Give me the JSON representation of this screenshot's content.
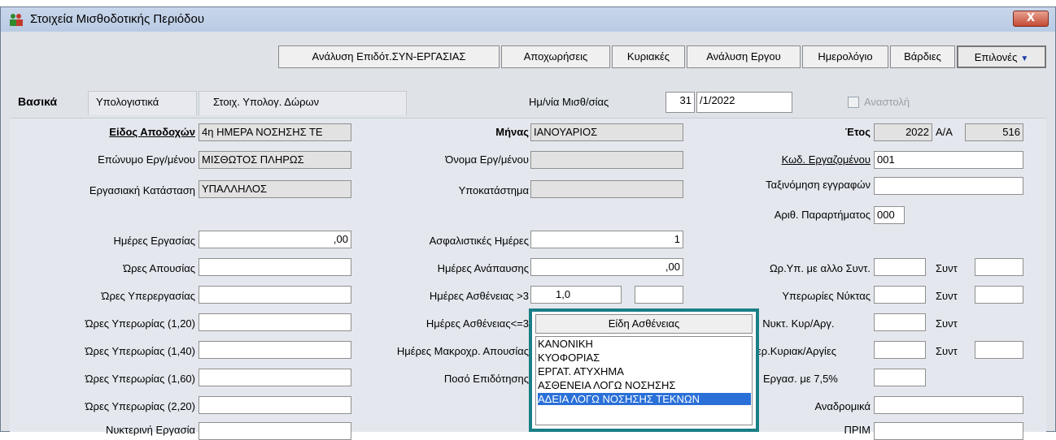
{
  "window": {
    "title": "Στοιχεία Μισθοδοτικής Περιόδου",
    "close": "X"
  },
  "toolbar": {
    "buttons": [
      "Ανάλυση Επιδότ.ΣΥΝ-ΕΡΓΑΣΙΑΣ",
      "Αποχωρήσεις",
      "Κυριακές",
      "Ανάλυση Εργου",
      "Ημερολόγιο",
      "Βάρδιες"
    ],
    "options": "Επιλονές"
  },
  "tabs": [
    "Βασικά",
    "Υπολογιστικά",
    "Στοιχ. Υπολογ. Δώρων"
  ],
  "header": {
    "date_label": "Ημ/νία Μισθ/σίας",
    "date_day": "31",
    "date_rest": "/1/2022",
    "suspend": "Αναστολή"
  },
  "form": {
    "income_type_label": "Είδος Αποδοχών",
    "income_type_value": "4η ΗΜΕΡΑ ΝΟΣΗΣΗΣ ΤΕ",
    "month_label": "Μήνας",
    "month_value": "ΙΑΝΟΥΑΡΙΟΣ",
    "year_label": "Έτος",
    "year_value": "2022",
    "aa_label": "Α/Α",
    "aa_value": "516",
    "surname_label": "Επώνυμο Εργ/μένου",
    "surname_value": "ΜΙΣΘΩΤΟΣ ΠΛΗΡΩΣ",
    "name_label": "Όνομα Εργ/μένου",
    "name_value": "",
    "emp_code_label": "Κωδ. Εργαζομένου",
    "emp_code_value": "001",
    "status_label": "Εργασιακή Κατάσταση",
    "status_value": "ΥΠΑΛΛΗΛΟΣ",
    "branch_label": "Υποκατάστημα",
    "branch_value": "",
    "sort_label": "Ταξινόμηση εγγραφών",
    "sort_value": "",
    "annex_label": "Αριθ. Παραρτήματος",
    "annex_value": "000",
    "work_days_label": "Ημέρες Εργασίας",
    "work_days_value": ",00",
    "ins_days_label": "Ασφαλιστικές Ημέρες",
    "ins_days_value": "1",
    "absence_hours_label": "Ώρες Απουσίας",
    "rest_days_label": "Ημέρες Ανάπαυσης",
    "rest_days_value": ",00",
    "overtime_other_label": "Ωρ.Υπ. με αλλο Συντ.",
    "synt_label": "Συντ",
    "overwork_label": "Ώρες Υπερεργασίας",
    "sick_gt3_label": "Ημέρες Ασθένειας >3",
    "sick_gt3_value": "1,0",
    "night_overtime_label": "Υπερωρίες Νύκτας",
    "overtime_120_label": "Ώρες Υπερωρίας (1,20)",
    "sick_le3_label": "Ημέρες Ασθένειας<=3",
    "night_sun_label": ". Νυκτ. Κυρ/Αργ.",
    "overtime_140_label": "Ώρες Υπερωρίας (1,40)",
    "long_absence_label": "Ημέρες Μακροχρ. Απουσίας",
    "sun_holiday_label": "ερ.Κυριακ/Αργίες",
    "overtime_160_label": "Ώρες Υπερωρίας (1,60)",
    "subsidy_label": "Ποσό Επιδότησης",
    "work75_label": "Εργασ. με 7,5%",
    "overtime_220_label": "Ώρες Υπερωρίας (2,20)",
    "retro_label": "Αναδρομικά",
    "night_work_label": "Νυκτερινή Εργασία",
    "prim_label": "ΠΡΙΜ"
  },
  "sickness_dropdown": {
    "header": "Είδη Ασθένειας",
    "items": [
      "ΚΑΝΟΝΙΚΗ",
      "ΚΥΟΦΟΡΙΑΣ",
      "ΕΡΓΑΤ. ΑΤΥΧΗΜΑ",
      "ΑΣΘΕΝΕΙΑ ΛΟΓΩ ΝΟΣΗΣΗΣ",
      "ΑΔΕΙΑ ΛΟΓΩ ΝΟΣΗΣΗΣ ΤΕΚΝΩΝ"
    ],
    "selected": "ΑΔΕΙΑ ΛΟΓΩ ΝΟΣΗΣΗΣ ΤΕΚΝΩΝ"
  }
}
